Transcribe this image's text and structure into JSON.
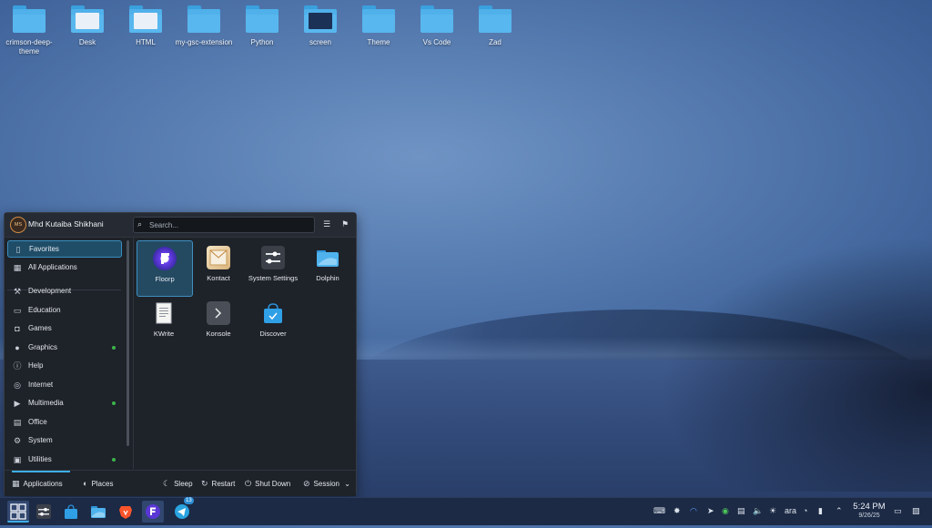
{
  "desktop": {
    "icons": [
      {
        "label": "crimson-deep-theme"
      },
      {
        "label": "Desk"
      },
      {
        "label": "HTML"
      },
      {
        "label": "my-gsc-extension"
      },
      {
        "label": "Python"
      },
      {
        "label": "screen"
      },
      {
        "label": "Theme"
      },
      {
        "label": "Vs Code"
      },
      {
        "label": "Zad"
      }
    ]
  },
  "launcher": {
    "user": {
      "name": "Mhd Kutaiba Shikhani",
      "initials": "MS"
    },
    "search": {
      "placeholder": "Search..."
    },
    "categories": [
      {
        "label": "Favorites",
        "icon": "star-icon"
      },
      {
        "label": "All Applications",
        "icon": "grid-icon"
      },
      {
        "label": "Development",
        "icon": "wrench-icon"
      },
      {
        "label": "Education",
        "icon": "monitor-icon"
      },
      {
        "label": "Games",
        "icon": "gamepad-icon"
      },
      {
        "label": "Graphics",
        "icon": "palette-icon",
        "badge": true
      },
      {
        "label": "Help",
        "icon": "info-icon"
      },
      {
        "label": "Internet",
        "icon": "globe-icon"
      },
      {
        "label": "Multimedia",
        "icon": "media-icon",
        "badge": true
      },
      {
        "label": "Office",
        "icon": "document-icon"
      },
      {
        "label": "System",
        "icon": "gear-icon"
      },
      {
        "label": "Utilities",
        "icon": "toolbox-icon",
        "badge": true
      }
    ],
    "favorites": [
      {
        "label": "Floorp",
        "icon": "floorp-icon"
      },
      {
        "label": "Kontact",
        "icon": "kontact-icon"
      },
      {
        "label": "System Settings",
        "icon": "settings-icon"
      },
      {
        "label": "Dolphin",
        "icon": "folder-icon"
      },
      {
        "label": "KWrite",
        "icon": "text-editor-icon"
      },
      {
        "label": "Konsole",
        "icon": "terminal-icon"
      },
      {
        "label": "Discover",
        "icon": "store-icon"
      }
    ],
    "footer": {
      "applications": "Applications",
      "places": "Places",
      "sleep": "Sleep",
      "restart": "Restart",
      "shutdown": "Shut Down",
      "session": "Session"
    }
  },
  "taskbar": {
    "notification_count": "13",
    "tray": {
      "keyboard_layout": "ara"
    },
    "clock": {
      "time": "5:24 PM",
      "date": "9/26/25"
    }
  },
  "colors": {
    "accent": "#3daee9",
    "badge": "#3cb34a",
    "panel": "#1c2a45"
  }
}
